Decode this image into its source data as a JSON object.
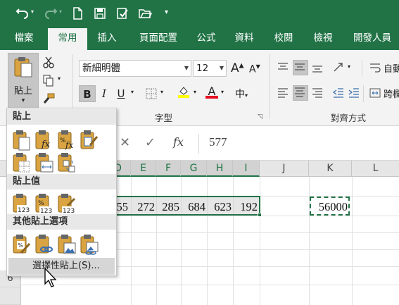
{
  "tabs": [
    "檔案",
    "常用",
    "插入",
    "頁面配置",
    "公式",
    "資料",
    "校閱",
    "檢視",
    "開發人員"
  ],
  "active_tab": "常用",
  "ribbon": {
    "paste_label": "貼上",
    "font_name": "新細明體",
    "font_size": "12",
    "group_font": "字型",
    "group_alignment": "對齊方式",
    "wrap_label": "自動",
    "merge_label": "跨欄",
    "bold": "B",
    "italic": "I",
    "underline": "U",
    "text_color_glyph": "A",
    "grow_font": "A",
    "shrink_font": "A",
    "phonetic": "中",
    "accent_green": "#217346",
    "font_color_bar": "#e81123",
    "fill_color_bar": "#ffff00"
  },
  "formula_bar": {
    "value": "577",
    "fx": "fx",
    "cancel_glyph": "✕",
    "enter_glyph": "✓"
  },
  "columns": [
    "D",
    "E",
    "F",
    "G",
    "H",
    "I",
    "J",
    "K",
    "L"
  ],
  "rows": [
    "6"
  ],
  "cells": {
    "row_values": [
      "55",
      "272",
      "285",
      "684",
      "623",
      "192"
    ],
    "copied_value": "56000"
  },
  "paste_menu": {
    "section_paste": "貼上",
    "section_values": "貼上值",
    "section_other": "其他貼上選項",
    "paste_special": "選擇性貼上(S)..."
  }
}
